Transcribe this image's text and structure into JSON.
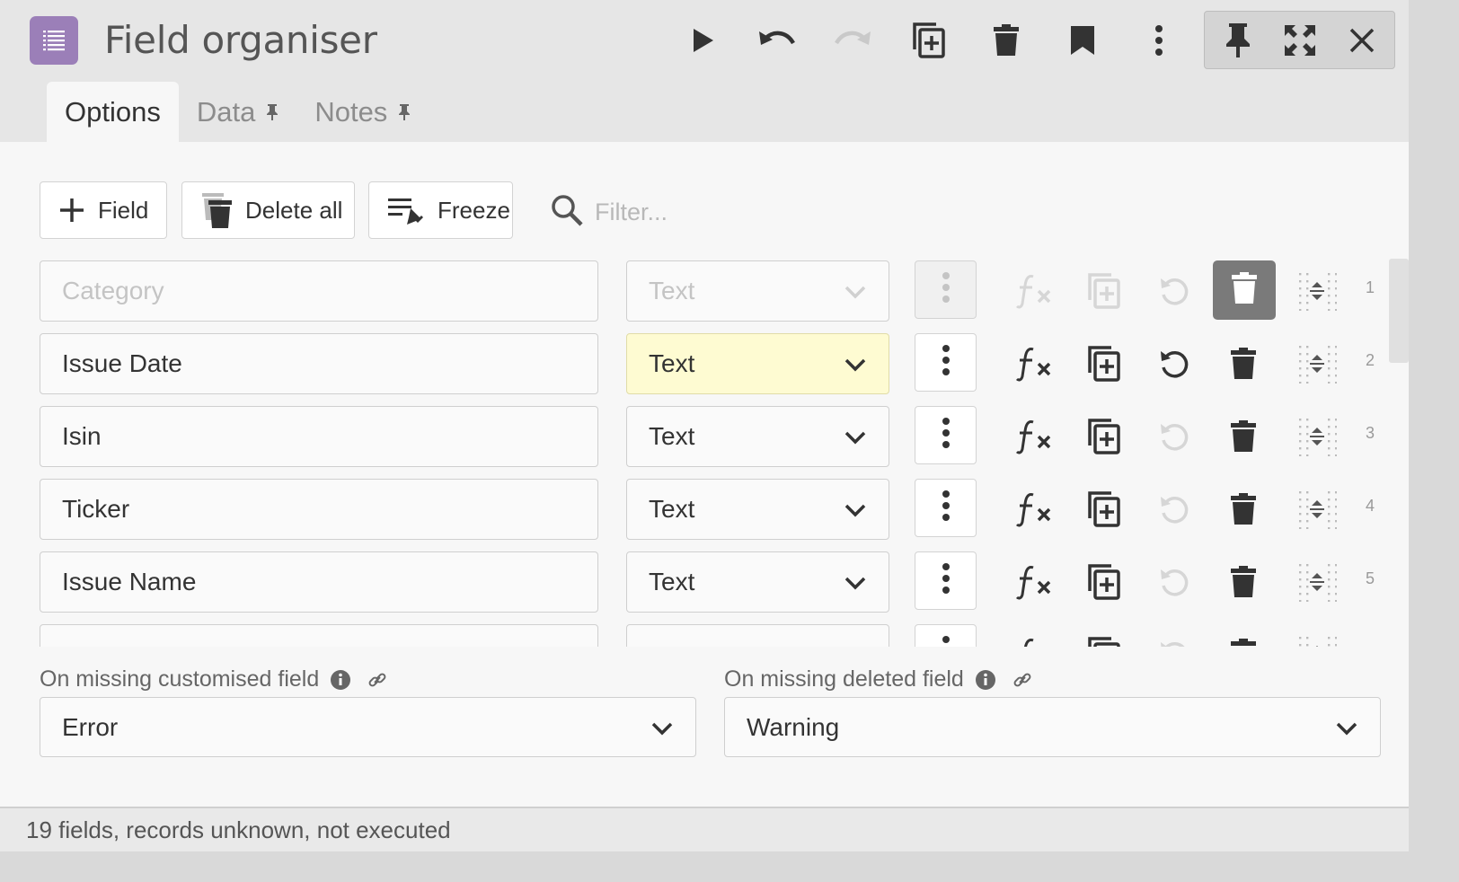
{
  "window": {
    "title": "Field organiser",
    "app_icon": "list-icon",
    "toolbar_icons": [
      "run-icon",
      "undo-icon",
      "redo-icon",
      "duplicate-icon",
      "trash-icon",
      "bookmark-icon",
      "more-vertical-icon"
    ],
    "window_icons": [
      "pin-icon",
      "fullscreen-icon",
      "close-icon"
    ]
  },
  "tabs": [
    {
      "label": "Options",
      "active": true,
      "pinned": false
    },
    {
      "label": "Data",
      "active": false,
      "pinned": true
    },
    {
      "label": "Notes",
      "active": false,
      "pinned": true
    }
  ],
  "toolbar": {
    "add_field_label": "Field",
    "delete_all_label": "Delete all",
    "freeze_label": "Freeze",
    "filter_placeholder": "Filter..."
  },
  "rows": [
    {
      "number": "1",
      "name": "",
      "name_placeholder": "Category",
      "type": "Text",
      "disabled": true
    },
    {
      "number": "2",
      "name": "Issue Date",
      "type": "Text",
      "highlighted": true,
      "reset_enabled": true
    },
    {
      "number": "3",
      "name": "Isin",
      "type": "Text"
    },
    {
      "number": "4",
      "name": "Ticker",
      "type": "Text"
    },
    {
      "number": "5",
      "name": "Issue Name",
      "type": "Text"
    }
  ],
  "missing_customised": {
    "label": "On missing customised field",
    "value": "Error"
  },
  "missing_deleted": {
    "label": "On missing deleted field",
    "value": "Warning"
  },
  "status": "19 fields, records unknown, not executed",
  "colors": {
    "app_icon": "#9b7fb8",
    "highlight": "#fefbd2",
    "header_bg": "#e6e6e6"
  }
}
